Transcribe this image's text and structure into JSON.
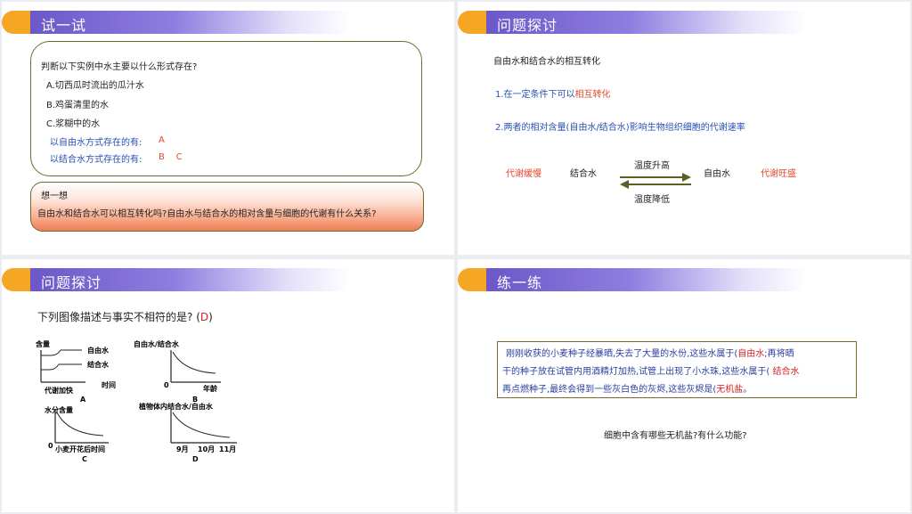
{
  "slide1": {
    "title": "试一试",
    "question": "判断以下实例中水主要以什么形式存在?",
    "options": [
      "A.切西瓜时流出的瓜汁水",
      "B.鸡蛋清里的水",
      "C.浆糊中的水"
    ],
    "free_label": "以自由水方式存在的有:",
    "free_answer": "A",
    "bound_label": "以结合水方式存在的有:",
    "bound_answer": "B    C",
    "think_title": "想一想",
    "think_text": "自由水和结合水可以相互转化吗?自由水与结合水的相对含量与细胞的代谢有什么关系?"
  },
  "slide2": {
    "title": "问题探讨",
    "heading": "自由水和结合水的相互转化",
    "point1_prefix": "1.在一定条件下可以",
    "point1_highlight": "相互转化",
    "point2": "2.两者的相对含量(自由水/结合水)影响生物组织细胞的代谢速率",
    "slow": "代谢缓慢",
    "bound": "结合水",
    "up": "温度升高",
    "down": "温度降低",
    "free": "自由水",
    "fast": "代谢旺盛",
    "colors": {
      "arrow": "#5c5d22",
      "accent_red": "#e24a2b",
      "blue": "#2a4fb5"
    }
  },
  "slide3": {
    "title": "问题探讨",
    "question": "下列图像描述与事实不相符的是?",
    "answer_open": "(",
    "answer": "D",
    "answer_close": ")",
    "graphA": {
      "ylabel": "含量",
      "line1": "自由水",
      "line2": "结合水",
      "xlabel": "代谢加快",
      "xlabel2": "时间",
      "letter": "A"
    },
    "graphB": {
      "ylabel": "自由水/结合水",
      "origin": "0",
      "xlabel": "年龄",
      "letter": "B"
    },
    "graphC": {
      "ylabel": "水分含量",
      "origin": "0",
      "xlabel": "小麦开花后时间",
      "letter": "C"
    },
    "graphD": {
      "ylabel": "植物体内结合水/自由水",
      "x_ticks": [
        "9月",
        "10月",
        "11月"
      ],
      "letter": "D"
    }
  },
  "slide4": {
    "title": "练一练",
    "line1_a": "刚刚收获的小麦种子经暴晒,失去了大量的水份,这些水属于(",
    "line1_ans": "自由水",
    "line1_b": ";再将晒",
    "line2_a": "干的种子放在试管内用酒精灯加热,试管上出现了小水珠,这些水属于(",
    "line2_ans": "结合水",
    "line3_a": "再点燃种子,最终会得到一些灰白色的灰烬,这些灰烬是(",
    "line3_ans": "无机盐",
    "line3_b": "。",
    "question": "细胞中含有哪些无机盐?有什么功能?"
  }
}
